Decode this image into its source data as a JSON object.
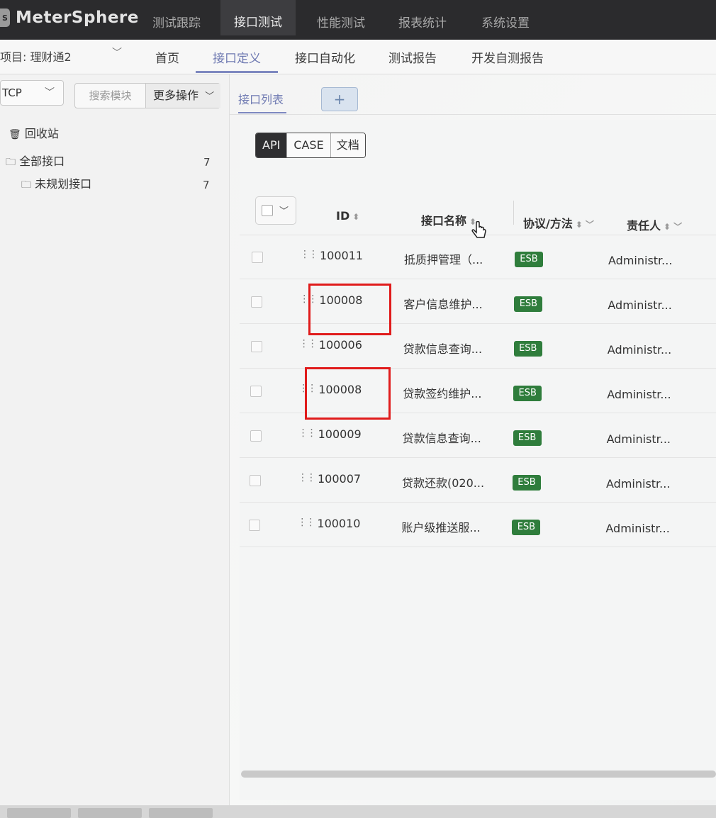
{
  "app": {
    "name": "MeterSphere",
    "top_nav": [
      "测试跟踪",
      "接口测试",
      "性能测试",
      "报表统计",
      "系统设置"
    ],
    "active_top": "接口测试"
  },
  "subbar": {
    "project": "项目: 理财通2",
    "items": [
      "首页",
      "接口定义",
      "接口自动化",
      "测试报告",
      "开发自测报告"
    ],
    "active": "接口定义"
  },
  "left": {
    "protocol": "TCP",
    "search_module": "搜索模块",
    "more_ops": "更多操作",
    "tree": [
      {
        "label": "回收站",
        "icon": "trash-icon",
        "count": ""
      },
      {
        "label": "全部接口",
        "icon": "folder-icon",
        "count": "7"
      },
      {
        "label": "未规划接口",
        "icon": "folder-icon",
        "count": "7"
      }
    ]
  },
  "main": {
    "tab_label": "接口列表",
    "add_tab": "+",
    "segments": [
      "API",
      "CASE",
      "文档"
    ],
    "active_segment": "API",
    "columns": [
      "ID",
      "接口名称",
      "协议/方法",
      "责任人"
    ],
    "rows": [
      {
        "id": "100011",
        "name": "抵质押管理（...",
        "protocol": "ESB",
        "owner": "Administr..."
      },
      {
        "id": "100008",
        "name": "客户信息维护...",
        "protocol": "ESB",
        "owner": "Administr..."
      },
      {
        "id": "100006",
        "name": "贷款信息查询...",
        "protocol": "ESB",
        "owner": "Administr..."
      },
      {
        "id": "100008",
        "name": "贷款签约维护...",
        "protocol": "ESB",
        "owner": "Administr..."
      },
      {
        "id": "100009",
        "name": "贷款信息查询...",
        "protocol": "ESB",
        "owner": "Administr..."
      },
      {
        "id": "100007",
        "name": "贷款还款(020...",
        "protocol": "ESB",
        "owner": "Administr..."
      },
      {
        "id": "100010",
        "name": "账户级推送服...",
        "protocol": "ESB",
        "owner": "Administr..."
      }
    ],
    "highlighted_rows": [
      1,
      3
    ],
    "colors": {
      "esb_badge": "#2f7d3c",
      "highlight": "#e01b1b",
      "accent": "#7e88c0"
    }
  }
}
